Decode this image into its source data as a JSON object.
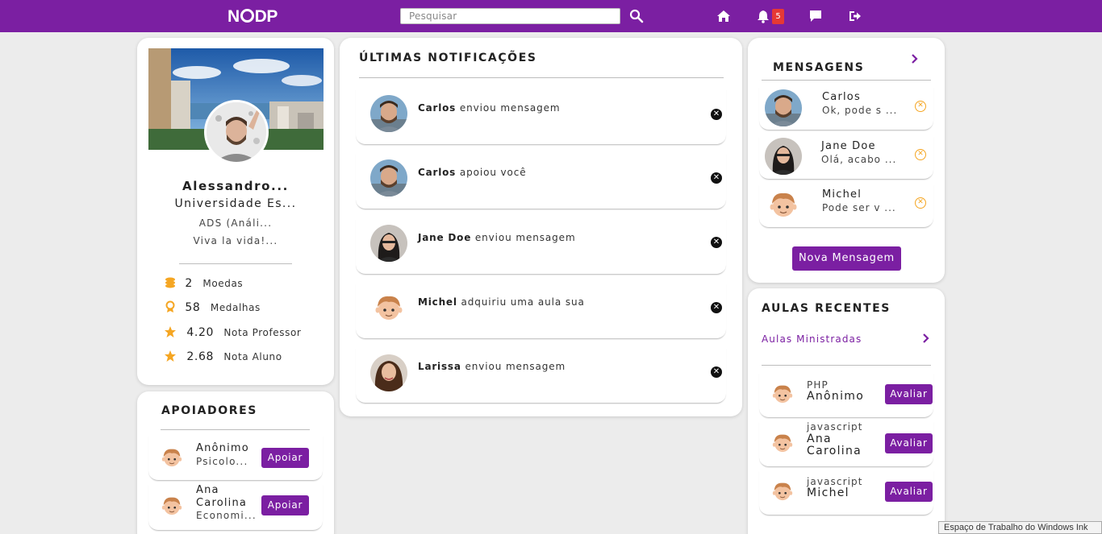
{
  "topbar": {
    "logo": "NODP",
    "search_placeholder": "Pesquisar",
    "notification_count": "5",
    "icons": [
      "search-icon",
      "home-icon",
      "bell-icon",
      "chat-icon",
      "logout-icon"
    ],
    "bg_color": "#7b1fa2"
  },
  "profile": {
    "name": "Alessandro...",
    "university": "Universidade Es...",
    "course": "ADS (Análi...",
    "bio": "Viva la vida!...",
    "stats": [
      {
        "value": "2",
        "label": "Moedas",
        "icon": "coins-icon"
      },
      {
        "value": "58",
        "label": "Medalhas",
        "icon": "medal-icon"
      },
      {
        "value": "4.20",
        "label": "Nota Professor",
        "icon": "star-icon"
      },
      {
        "value": "2.68",
        "label": "Nota Aluno",
        "icon": "star-icon"
      }
    ]
  },
  "supporters": {
    "title": "APOIADORES",
    "button_label": "Apoiar",
    "items": [
      {
        "name": "Anônimo",
        "sub": "Psicolo..."
      },
      {
        "name": "Ana Carolina",
        "name_line1": "Ana",
        "name_line2": "Carolina",
        "sub": "Economi..."
      }
    ]
  },
  "notifications": {
    "title": "ÚLTIMAS NOTIFICAÇÕES",
    "items": [
      {
        "user": "Carlos",
        "text": "enviou mensagem"
      },
      {
        "user": "Carlos",
        "text": "apoiou você"
      },
      {
        "user": "Jane Doe",
        "text": "enviou mensagem"
      },
      {
        "user": "Michel",
        "text": "adquiriu uma aula sua"
      },
      {
        "user": "Larissa",
        "text": "enviou mensagem"
      }
    ],
    "close_glyph": "✕"
  },
  "messages": {
    "title": "MENSAGENS",
    "new_button": "Nova Mensagem",
    "items": [
      {
        "name": "Carlos",
        "preview": "Ok, pode s ..."
      },
      {
        "name": "Jane Doe",
        "preview": "Olá, acabo ..."
      },
      {
        "name": "Michel",
        "preview": "Pode ser v ..."
      }
    ],
    "remove_glyph": "✕"
  },
  "classes": {
    "title": "AULAS RECENTES",
    "link": "Aulas Ministradas",
    "button_label": "Avaliar",
    "items": [
      {
        "subject": "PHP",
        "name": "Anônimo",
        "name_line1": "Anônimo",
        "name_line2": ""
      },
      {
        "subject": "javascript",
        "name": "Ana Carolina",
        "name_line1": "Ana",
        "name_line2": "Carolina"
      },
      {
        "subject": "javascript",
        "name": "Michel",
        "name_line1": "Michel",
        "name_line2": ""
      }
    ]
  },
  "taskbar_tooltip": "Espaço de Trabalho do Windows Ink",
  "colors": {
    "primary": "#7b1fa2",
    "accent": "#f5a623",
    "badge": "#e53935"
  }
}
